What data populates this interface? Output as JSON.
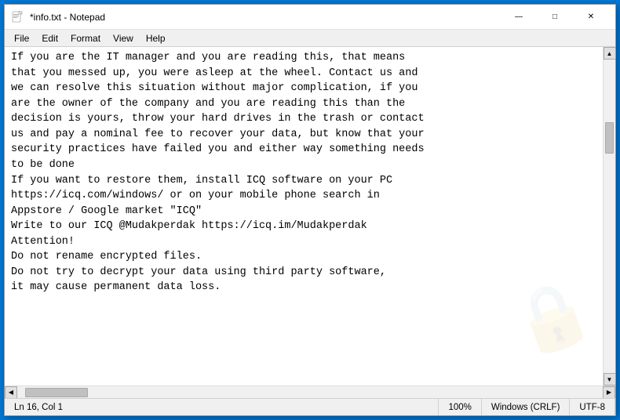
{
  "titleBar": {
    "title": "*info.txt - Notepad",
    "minimizeLabel": "—",
    "maximizeLabel": "□",
    "closeLabel": "✕"
  },
  "menuBar": {
    "items": [
      "File",
      "Edit",
      "Format",
      "View",
      "Help"
    ]
  },
  "editor": {
    "content": "If you are the IT manager and you are reading this, that means\nthat you messed up, you were asleep at the wheel. Contact us and\nwe can resolve this situation without major complication, if you\nare the owner of the company and you are reading this than the\ndecision is yours, throw your hard drives in the trash or contact\nus and pay a nominal fee to recover your data, but know that your\nsecurity practices have failed you and either way something needs\nto be done\nIf you want to restore them, install ICQ software on your PC\nhttps://icq.com/windows/ or on your mobile phone search in\nAppstore / Google market \"ICQ\"\nWrite to our ICQ @Mudakperdak https://icq.im/Mudakperdak\nAttention!\nDo not rename encrypted files.\nDo not try to decrypt your data using third party software,\nit may cause permanent data loss."
  },
  "statusBar": {
    "position": "Ln 16, Col 1",
    "zoom": "100%",
    "lineEnding": "Windows (CRLF)",
    "encoding": "UTF-8"
  },
  "watermark": {
    "text": "🔒"
  }
}
